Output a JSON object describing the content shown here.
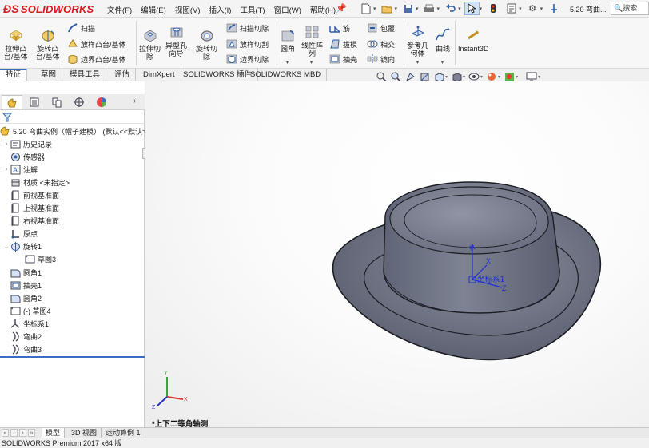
{
  "app": {
    "logo": "SOLIDWORKS",
    "doc_title": "5.20 弯曲...",
    "search_placeholder": "搜索"
  },
  "menu": [
    "文件(F)",
    "编辑(E)",
    "视图(V)",
    "插入(I)",
    "工具(T)",
    "窗口(W)",
    "帮助(H)"
  ],
  "ribbon": {
    "extrude_boss": "拉伸凸\n台/基体",
    "revolve_boss": "旋转凸\n台/基体",
    "sweep": "扫描",
    "loft_boss": "放样凸台/基体",
    "boundary_boss": "边界凸台/基体",
    "extrude_cut": "拉伸切\n除",
    "hole_wizard": "异型孔\n向导",
    "revolve_cut": "旋转切\n除",
    "sweep_cut": "扫描切除",
    "loft_cut": "放样切割",
    "boundary_cut": "边界切除",
    "fillet": "圆角",
    "linear_pattern": "线性阵\n列",
    "rib": "筋",
    "draft": "拔模",
    "shell": "抽壳",
    "wrap": "包覆",
    "intersect": "相交",
    "mirror": "镜向",
    "ref_geometry": "参考几\n何体",
    "curves": "曲线",
    "instant3d": "Instant3D"
  },
  "command_tabs": [
    {
      "label": "特征",
      "active": true
    },
    {
      "label": "草图",
      "active": false
    },
    {
      "label": "模具工具",
      "active": false
    },
    {
      "label": "评估",
      "active": false
    },
    {
      "label": "DimXpert",
      "active": false
    },
    {
      "label": "SOLIDWORKS 插件",
      "active": false
    },
    {
      "label": "SOLIDWORKS MBD",
      "active": false
    }
  ],
  "tree": {
    "root": "5.20 弯曲实例（帽子建模）  (默认<<默认>",
    "items": [
      {
        "label": "历史记录",
        "icon": "history-icon",
        "expander": "›",
        "indent": 0
      },
      {
        "label": "传感器",
        "icon": "sensor-icon",
        "expander": "",
        "indent": 0
      },
      {
        "label": "注解",
        "icon": "annotation-icon",
        "expander": "›",
        "indent": 0
      },
      {
        "label": "材质 <未指定>",
        "icon": "material-icon",
        "expander": "",
        "indent": 0
      },
      {
        "label": "前视基准面",
        "icon": "plane-icon",
        "expander": "",
        "indent": 0
      },
      {
        "label": "上视基准面",
        "icon": "plane-icon",
        "expander": "",
        "indent": 0
      },
      {
        "label": "右视基准面",
        "icon": "plane-icon",
        "expander": "",
        "indent": 0
      },
      {
        "label": "原点",
        "icon": "origin-icon",
        "expander": "",
        "indent": 0
      },
      {
        "label": "旋转1",
        "icon": "revolve-feature-icon",
        "expander": "⌄",
        "indent": 0
      },
      {
        "label": "草图3",
        "icon": "sketch-icon",
        "expander": "",
        "indent": 1
      },
      {
        "label": "圆角1",
        "icon": "fillet-feature-icon",
        "expander": "",
        "indent": 0
      },
      {
        "label": "抽壳1",
        "icon": "shell-feature-icon",
        "expander": "",
        "indent": 0
      },
      {
        "label": "圆角2",
        "icon": "fillet-feature-icon",
        "expander": "",
        "indent": 0
      },
      {
        "label": "(-) 草图4",
        "icon": "sketch-icon",
        "expander": "",
        "indent": 0
      },
      {
        "label": "坐标系1",
        "icon": "coordinate-system-icon",
        "expander": "",
        "indent": 0
      },
      {
        "label": "弯曲2",
        "icon": "flex-feature-icon",
        "expander": "",
        "indent": 0
      },
      {
        "label": "弯曲3",
        "icon": "flex-feature-icon",
        "expander": "",
        "indent": 0
      }
    ]
  },
  "viewport": {
    "view_label": "*上下二等角轴测",
    "coord_label": "坐标系1",
    "axis_x": "X",
    "axis_y": "Y",
    "axis_z": "Z"
  },
  "bottom_tabs": [
    {
      "label": "模型",
      "active": true
    },
    {
      "label": "3D 视图",
      "active": false
    },
    {
      "label": "运动算例 1",
      "active": false
    }
  ],
  "status": "SOLIDWORKS Premium 2017 x64 版",
  "colors": {
    "brand": "#d71920",
    "accent": "#3a6dc4",
    "model": "#6b7080"
  }
}
